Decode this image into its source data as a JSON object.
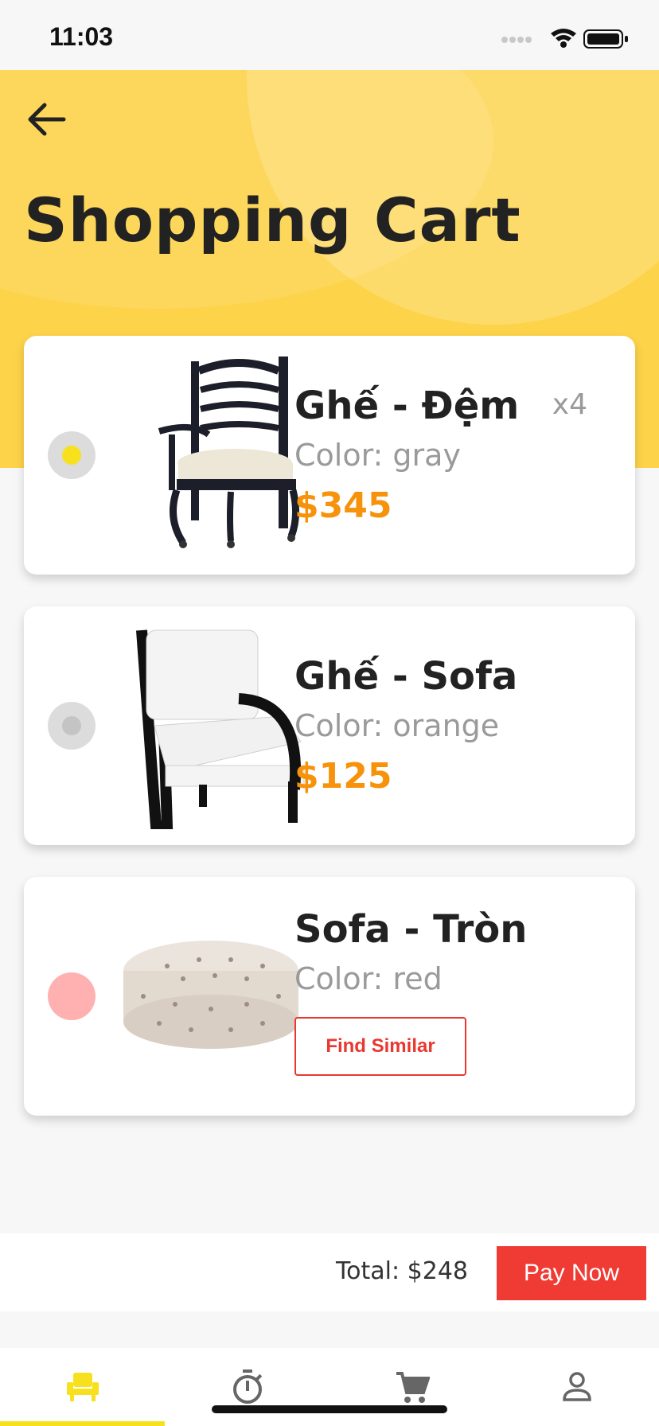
{
  "status_bar": {
    "time": "11:03"
  },
  "header": {
    "title": "Shopping Cart"
  },
  "cart": {
    "items": [
      {
        "name": "Ghế - Đệm",
        "color": "Color: gray",
        "price": "$345",
        "quantity": "x4",
        "radio_color": "#f7e11f",
        "selected": true
      },
      {
        "name": "Ghế - Sofa",
        "color": "Color: orange",
        "price": "$125",
        "radio_color": "#c4c4c4",
        "selected": false
      },
      {
        "name": "Sofa - Tròn",
        "color": "Color: red",
        "action_label": "Find Similar",
        "radio_color": "#ffb0b0",
        "unavailable": true
      }
    ]
  },
  "checkout": {
    "total": "Total: $248",
    "pay_label": "Pay Now"
  },
  "tab_bar": {
    "tabs": [
      {
        "icon": "armchair-icon",
        "active": true
      },
      {
        "icon": "stopwatch-icon",
        "active": false
      },
      {
        "icon": "cart-icon",
        "active": false
      },
      {
        "icon": "person-icon",
        "active": false
      }
    ]
  },
  "colors": {
    "accent": "#fdd34a",
    "price": "#f7920b",
    "danger": "#ef3b34",
    "active_tab": "#f7e11f"
  }
}
